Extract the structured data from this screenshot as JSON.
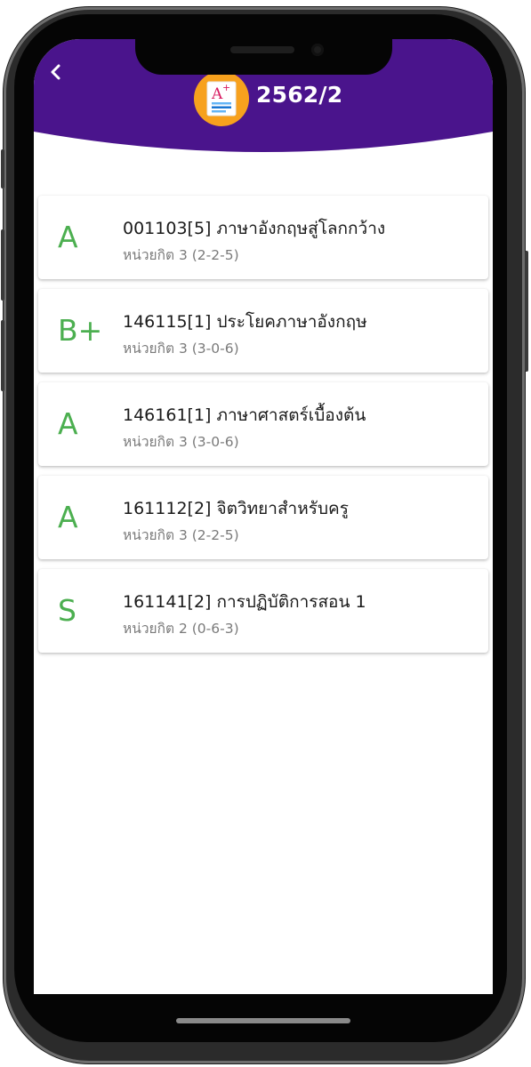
{
  "header": {
    "title": "2562/2",
    "logo_icon": "grade-a-plus-icon",
    "back_icon": "chevron-left-icon",
    "background_color": "#4a148c",
    "logo_color": "#f7a11d"
  },
  "courses": [
    {
      "grade": "A",
      "name": "001103[5] ภาษาอังกฤษสู่โลกกว้าง",
      "credit": "หน่วยกิต 3 (2-2-5)"
    },
    {
      "grade": "B+",
      "name": "146115[1] ประโยคภาษาอังกฤษ",
      "credit": "หน่วยกิต 3 (3-0-6)"
    },
    {
      "grade": "A",
      "name": "146161[1] ภาษาศาสตร์เบื้องต้น",
      "credit": "หน่วยกิต 3 (3-0-6)"
    },
    {
      "grade": "A",
      "name": "161112[2] จิตวิทยาสำหรับครู",
      "credit": "หน่วยกิต 3 (2-2-5)"
    },
    {
      "grade": "S",
      "name": "161141[2] การปฏิบัติการสอน 1",
      "credit": "หน่วยกิต 2 (0-6-3)"
    }
  ],
  "colors": {
    "grade": "#4caf50"
  }
}
